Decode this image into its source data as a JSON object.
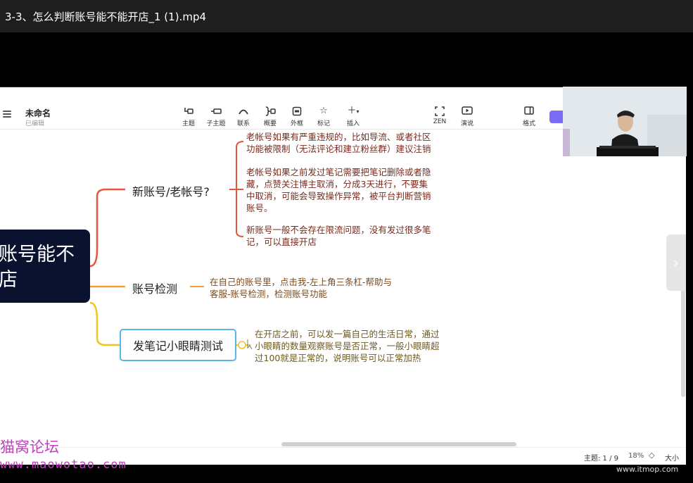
{
  "player": {
    "title": "3-3、怎么判断账号能不能开店_1 (1).mp4"
  },
  "app": {
    "doc_title": "未命名",
    "doc_status": "已编辑",
    "toolbar": [
      {
        "id": "topic",
        "label": "主题",
        "icon": "topic-icon"
      },
      {
        "id": "subtopic",
        "label": "子主题",
        "icon": "subtopic-icon"
      },
      {
        "id": "relation",
        "label": "联系",
        "icon": "relation-icon"
      },
      {
        "id": "summary",
        "label": "概要",
        "icon": "summary-icon"
      },
      {
        "id": "boundary",
        "label": "外框",
        "icon": "boundary-icon"
      },
      {
        "id": "marker",
        "label": "标记",
        "icon": "star-icon"
      },
      {
        "id": "insert",
        "label": "插入",
        "icon": "plus-icon"
      },
      {
        "id": "zen",
        "label": "ZEN",
        "icon": "zen-icon"
      },
      {
        "id": "present",
        "label": "演说",
        "icon": "play-icon"
      },
      {
        "id": "format",
        "label": "格式",
        "icon": "format-icon"
      }
    ]
  },
  "mindmap": {
    "root": {
      "line1": "账号能不",
      "line2": "店"
    },
    "branches": [
      {
        "label": "新账号/老帐号?",
        "color": "#e8553a",
        "notes": [
          {
            "lines": [
              "老帐号如果有严重违规的，比如导流、或者社区",
              "功能被限制（无法评论和建立粉丝群）建议注销"
            ]
          },
          {
            "lines": [
              "老帐号如果之前发过笔记需要把笔记删除或者隐",
              "藏，点赞关注博主取消，分成3天进行，不要集",
              "中取消，可能会导致操作异常，被平台判断营销",
              "账号。"
            ]
          },
          {
            "lines": [
              "新账号一般不会存在限流问题，没有发过很多笔",
              "记，可以直接开店"
            ]
          }
        ]
      },
      {
        "label": "账号检测",
        "color": "#f2a13a",
        "notes": [
          {
            "lines": [
              "在自己的账号里，点击我-左上角三条杠-帮助与",
              "客服-账号检测，检测账号功能"
            ]
          }
        ]
      },
      {
        "label": "发笔记小眼睛测试",
        "color": "#f2c21e",
        "notes": [
          {
            "lines": [
              "在开店之前，可以发一篇自己的生活日常，通过",
              "小眼睛的数量观察账号是否正常，一般小眼睛超",
              "过100就是正常的，说明账号可以正常加热"
            ]
          }
        ]
      }
    ]
  },
  "status": {
    "topic_count": "主题: 1 / 9",
    "zoom": "18%",
    "zoom_control": "◇",
    "size": "大小"
  },
  "watermarks": {
    "cn": "猫窝论坛",
    "url": "www.maowotao.com",
    "itmop": "www.itmop.com"
  }
}
